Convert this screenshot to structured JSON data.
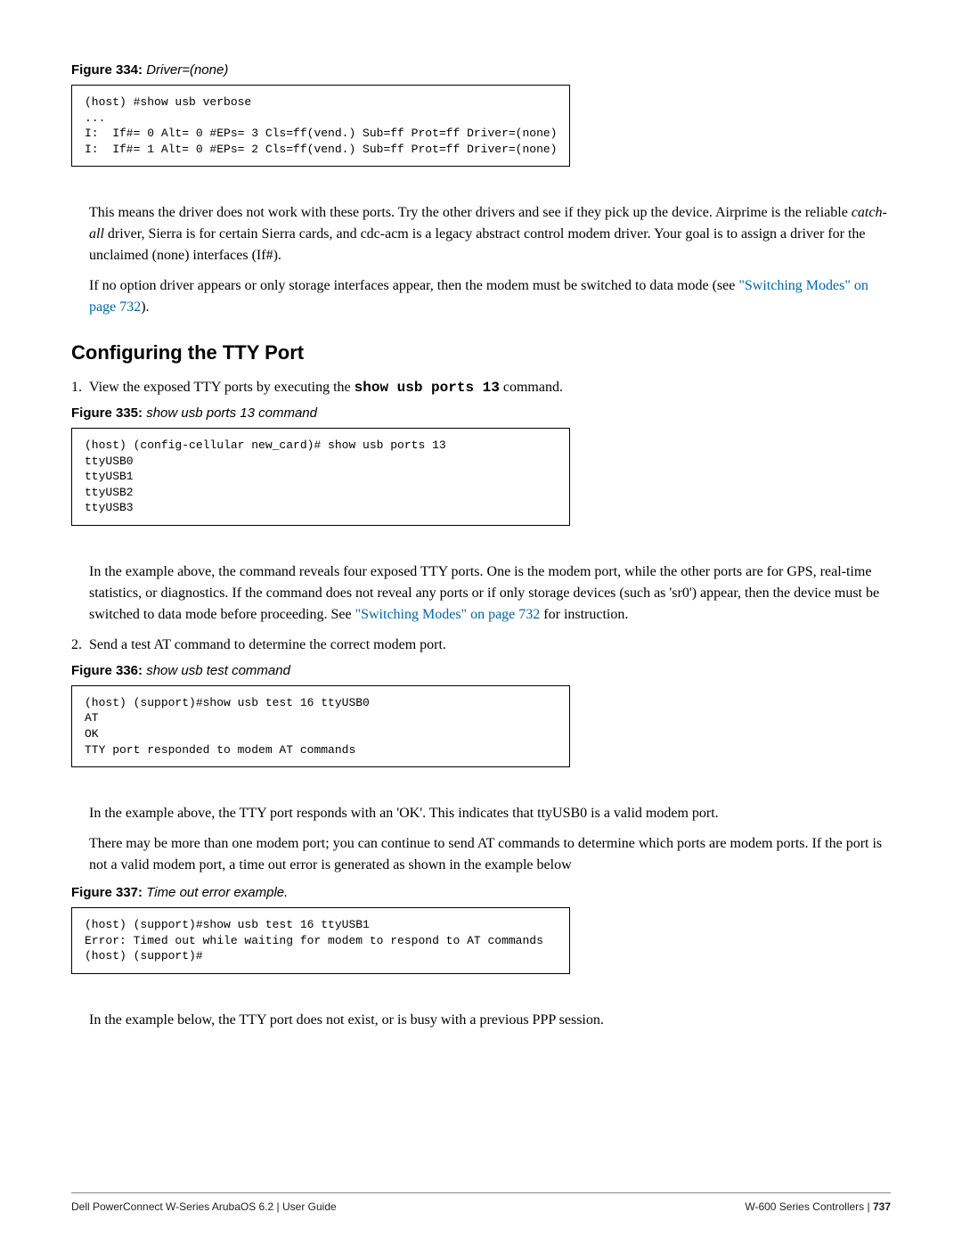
{
  "figures": {
    "f334": {
      "label": "Figure 334:",
      "title": "Driver=(none)",
      "code": "(host) #show usb verbose\n...\nI:  If#= 0 Alt= 0 #EPs= 3 Cls=ff(vend.) Sub=ff Prot=ff Driver=(none)\nI:  If#= 1 Alt= 0 #EPs= 2 Cls=ff(vend.) Sub=ff Prot=ff Driver=(none)"
    },
    "f335": {
      "label": "Figure 335:",
      "title": "show usb ports 13 command",
      "code": "(host) (config-cellular new_card)# show usb ports 13\nttyUSB0\nttyUSB1\nttyUSB2\nttyUSB3"
    },
    "f336": {
      "label": "Figure 336:",
      "title": "show usb test command",
      "code": "(host) (support)#show usb test 16 ttyUSB0\nAT\nOK\nTTY port responded to modem AT commands"
    },
    "f337": {
      "label": "Figure 337:",
      "title": "Time out error example.",
      "code": "(host) (support)#show usb test 16 ttyUSB1\nError: Timed out while waiting for modem to respond to AT commands\n(host) (support)#"
    }
  },
  "paragraphs": {
    "p1a": "This means the driver does not work with these ports. Try the other drivers and see if they pick up the device. Airprime is the reliable ",
    "p1_catchall": "catch-all",
    "p1b": " driver, Sierra is for certain Sierra cards, and cdc-acm is a legacy abstract control modem driver. Your goal is to assign a driver for the unclaimed (none) interfaces (If#).",
    "p2a": "If no option driver appears or only storage interfaces appear, then the modem must be switched to data mode (see ",
    "p2_link": "\"Switching Modes\" on page 732",
    "p2b": ").",
    "p3a": "In the example above, the command reveals four exposed TTY ports. One is the modem port, while the other ports are for GPS, real-time statistics, or diagnostics. If the command does not reveal any ports or if only storage devices (such as 'sr0') appear, then the device must be switched to data mode before proceeding. See ",
    "p3_link": "\"Switching Modes\" on page 732",
    "p3b": " for instruction.",
    "p4": "In the example above, the TTY port responds with an 'OK'. This indicates that ttyUSB0 is a valid modem port.",
    "p5": "There may be more than one modem port; you can continue to send AT commands to determine which ports are modem ports. If the port is not a valid modem port, a time out error is generated as shown in the example below",
    "p6": "In the example below, the TTY port does not exist, or is busy with a previous PPP session."
  },
  "heading": "Configuring the TTY Port",
  "list": {
    "i1_num": "1.",
    "i1_a": "View the exposed TTY ports by executing the ",
    "i1_cmd": "show usb ports 13",
    "i1_b": " command.",
    "i2_num": "2.",
    "i2": "Send a test AT command to determine the correct modem port."
  },
  "footer": {
    "left": "Dell PowerConnect W-Series ArubaOS 6.2  |  User Guide",
    "right_section": "W-600 Series  Controllers",
    "right_sep": " | ",
    "right_page": "737"
  }
}
